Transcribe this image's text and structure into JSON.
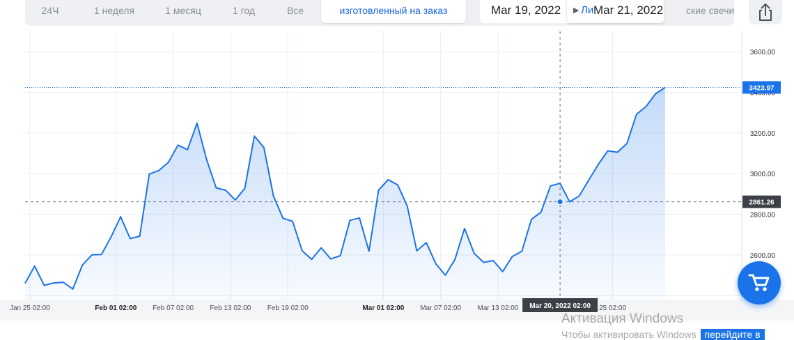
{
  "toolbar": {
    "tabs": [
      {
        "label": "24Ч",
        "active": false
      },
      {
        "label": "1 неделя",
        "active": false
      },
      {
        "label": "1 месяц",
        "active": false
      },
      {
        "label": "1 год",
        "active": false
      },
      {
        "label": "Все",
        "active": false
      },
      {
        "label": "изготовленный на заказ",
        "active": true
      }
    ],
    "date_from": "Mar 19, 2022",
    "date_to": "Mar 21, 2022",
    "style_label_fragment": "Ли",
    "style_label_tail": "ские свечи"
  },
  "crosshair_time_label": "Mar 20, 2022 02:00",
  "crosshair_price_label": "2861.26",
  "last_price_label": "3423.97",
  "watermark": {
    "title": "Активация Windows",
    "subtitle_fragment": "Чтобы активировать Windows",
    "subtitle_tail": "перейдите в"
  },
  "icons": {
    "share": "share-icon",
    "cart": "cart-icon",
    "dropdown": "caret-right-icon"
  },
  "colors": {
    "line": "#1a73e8",
    "accent": "#1a66e6",
    "last_price_tag": "#1a73e8",
    "crosshair_tag": "#3c3f46"
  },
  "chart_data": {
    "type": "area",
    "title": "",
    "xlabel": "",
    "ylabel": "",
    "ylim": [
      2380,
      3700
    ],
    "y_ticks": [
      2600,
      2800,
      3000,
      3200,
      3400,
      3600
    ],
    "y_tick_labels": [
      "2600.00",
      "2800.00",
      "3000.00",
      "3200.00",
      "3400.00",
      "3600.00"
    ],
    "x_tick_labels": [
      {
        "label": "Jan 25 02:00",
        "bold": false,
        "index": 0.5
      },
      {
        "label": "Feb 01 02:00",
        "bold": true,
        "index": 9.5
      },
      {
        "label": "Feb 07 02:00",
        "bold": false,
        "index": 15.5
      },
      {
        "label": "Feb 13 02:00",
        "bold": false,
        "index": 21.5
      },
      {
        "label": "Feb 19 02:00",
        "bold": false,
        "index": 27.5
      },
      {
        "label": "Mar 01 02:00",
        "bold": true,
        "index": 37.5
      },
      {
        "label": "Mar 07 02:00",
        "bold": false,
        "index": 43.5
      },
      {
        "label": "Mar 13 02:00",
        "bold": false,
        "index": 49.5
      },
      {
        "label": "25 02:00",
        "bold": false,
        "index": 61.5
      }
    ],
    "last_value": 3423.97,
    "crosshair": {
      "index": 56,
      "value": 2861.26
    },
    "grid": true,
    "series": [
      {
        "values": [
          2460,
          2545,
          2450,
          2462,
          2465,
          2432,
          2550,
          2600,
          2602,
          2688,
          2788,
          2680,
          2692,
          2998,
          3015,
          3055,
          3140,
          3118,
          3248,
          3070,
          2930,
          2918,
          2870,
          2928,
          3185,
          3128,
          2890,
          2780,
          2765,
          2620,
          2578,
          2635,
          2580,
          2596,
          2770,
          2782,
          2618,
          2918,
          2970,
          2945,
          2840,
          2620,
          2660,
          2556,
          2500,
          2578,
          2730,
          2608,
          2563,
          2572,
          2518,
          2592,
          2618,
          2775,
          2810,
          2940,
          2952,
          2861.26,
          2890,
          2968,
          3045,
          3112,
          3105,
          3148,
          3292,
          3330,
          3393,
          3423.97
        ]
      }
    ]
  }
}
